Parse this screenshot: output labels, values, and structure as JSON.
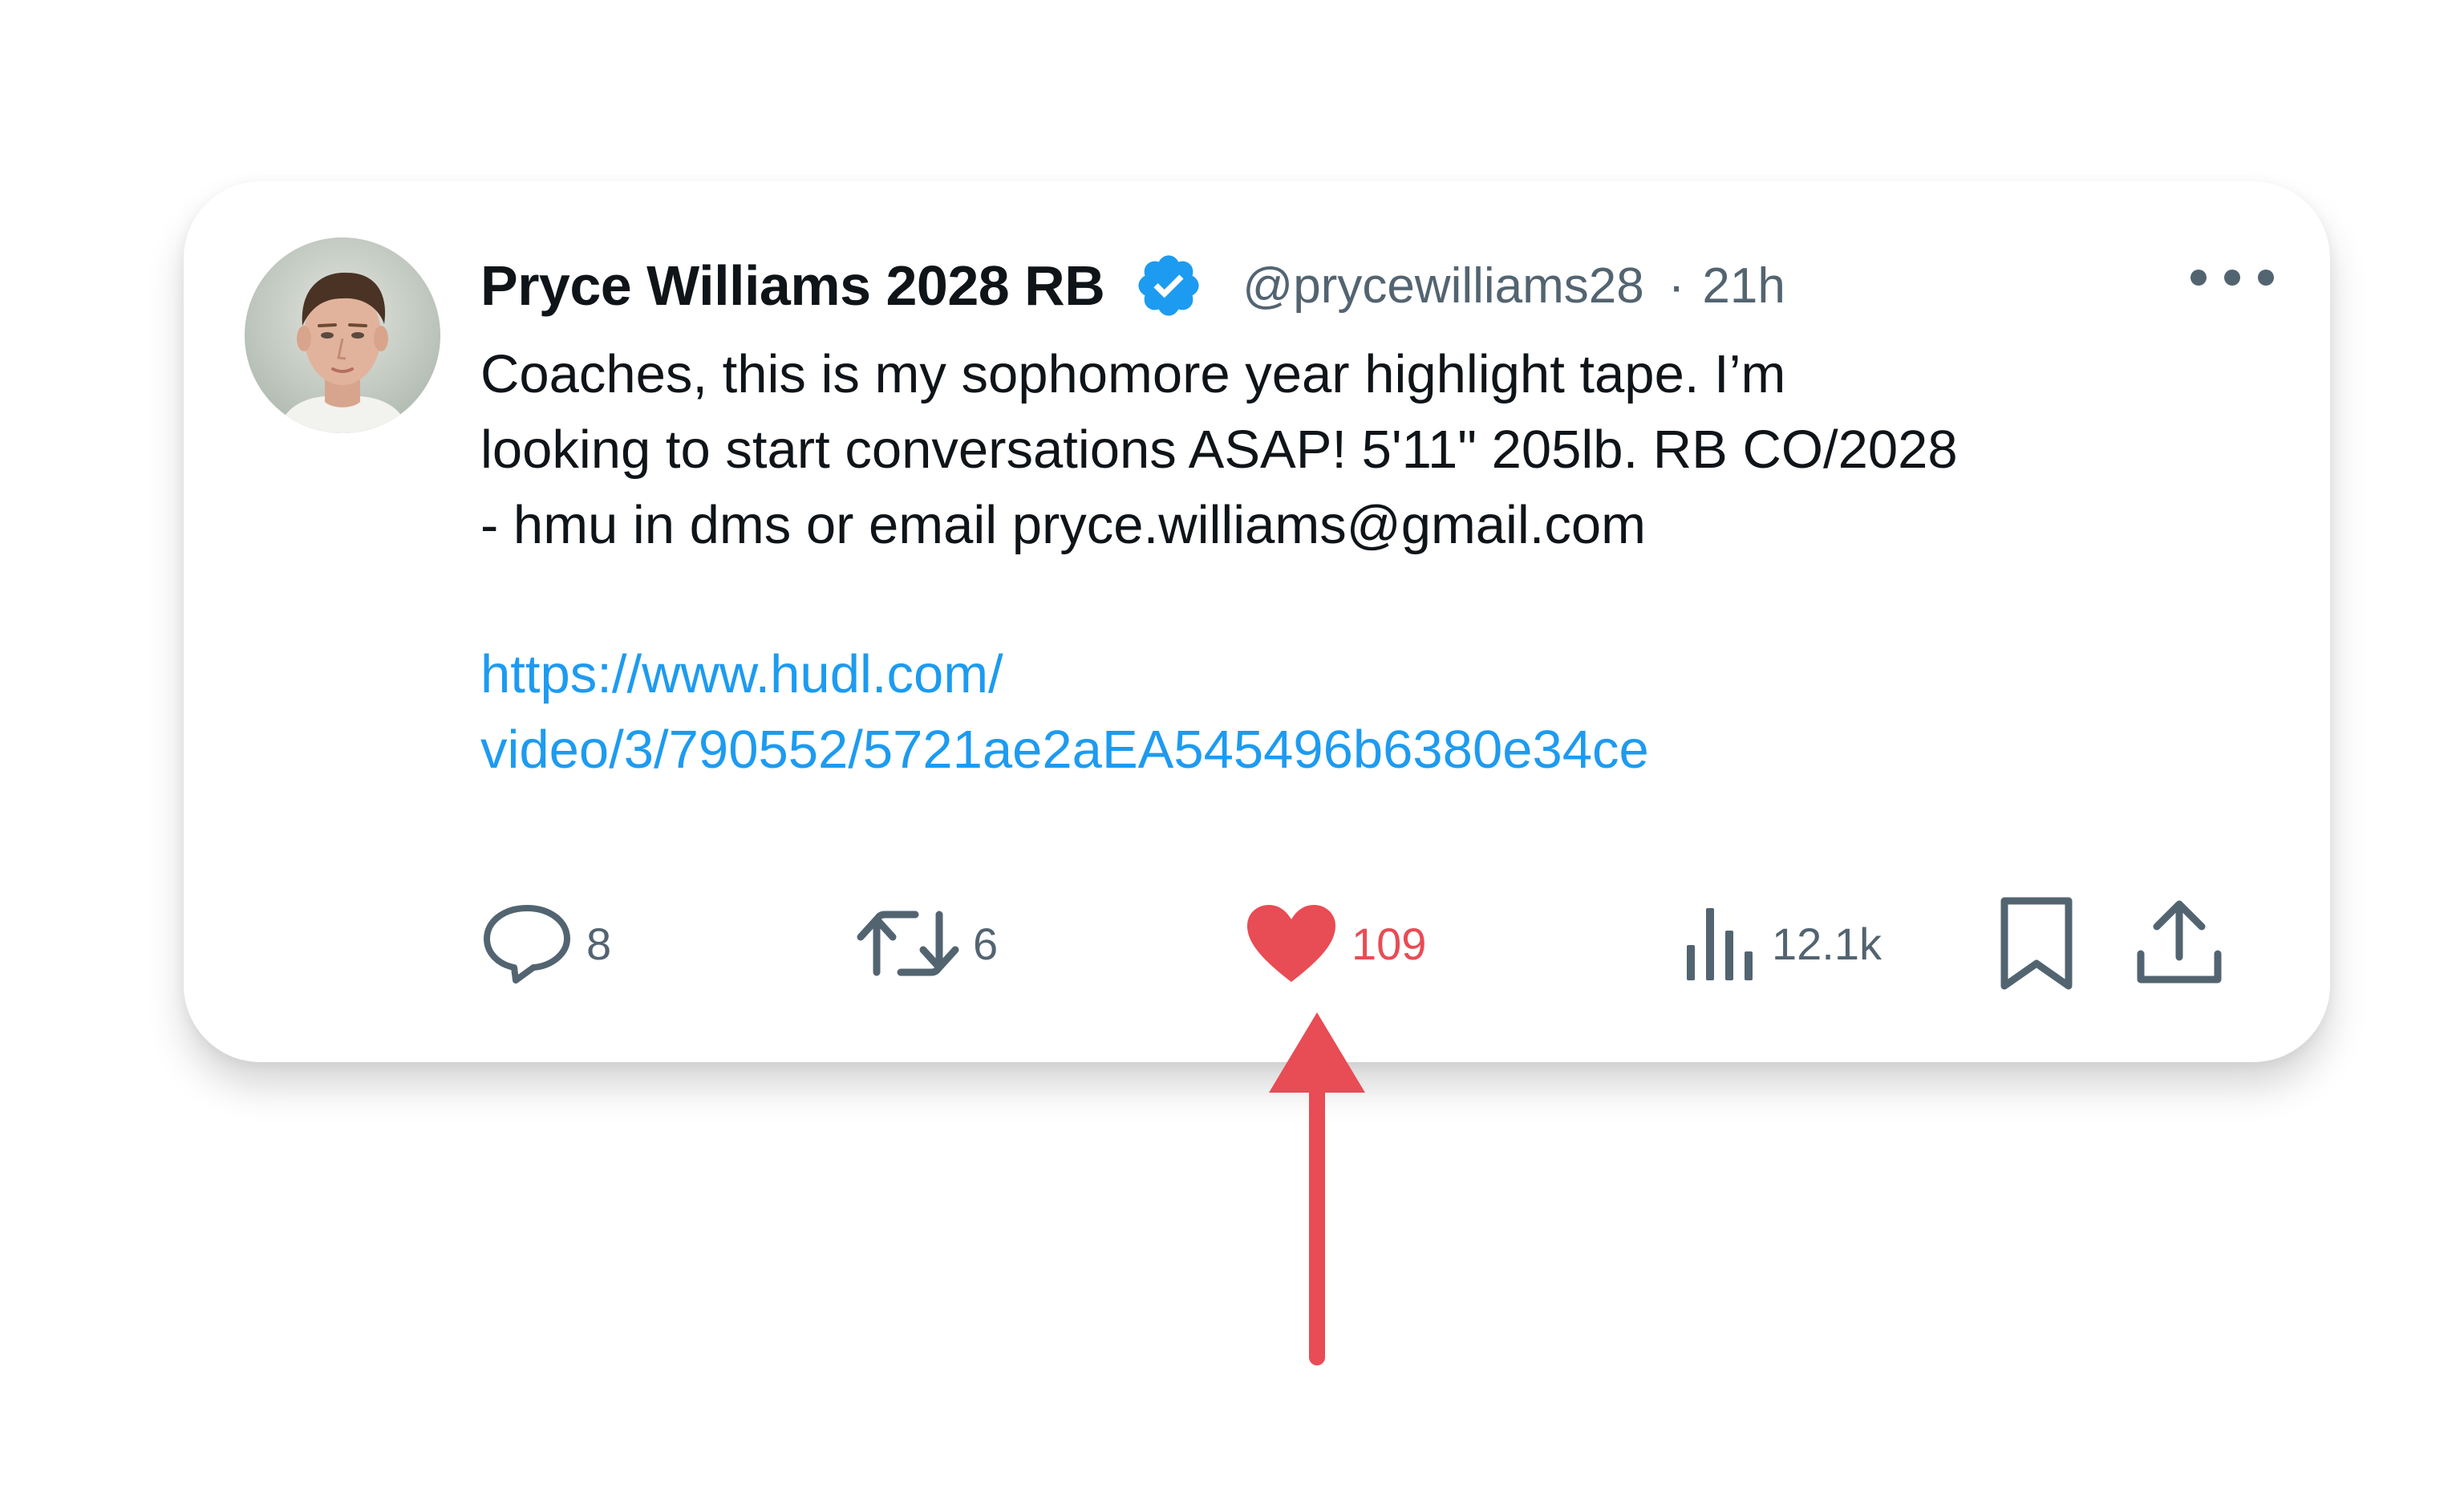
{
  "tweet": {
    "display_name": "Pryce Williams 2028 RB",
    "handle": "@prycewilliams28",
    "separator": "·",
    "time": "21h",
    "text_lines": [
      "Coaches, this is my sophomore year highlight tape. I’m",
      "looking to start conversations ASAP! 5'11\" 205lb. RB CO/2028",
      "- hmu in dms or email pryce.williams@gmail.com"
    ],
    "link_lines": [
      "https://www.hudl.com/",
      "video/3/790552/5721ae2aEA545496b6380e34ce"
    ]
  },
  "actions": {
    "replies": "8",
    "reposts": "6",
    "likes": "109",
    "views": "12.1k"
  },
  "icons": {
    "verified": "verified-badge-icon",
    "more": "more-options-icon",
    "reply": "reply-icon",
    "repost": "repost-icon",
    "like": "heart-icon",
    "views": "views-chart-icon",
    "bookmark": "bookmark-icon",
    "share": "share-upload-icon"
  },
  "colors": {
    "verified_blue": "#1d9bf0",
    "link_blue": "#1d9bf0",
    "like_red": "#e84c55",
    "icon_gray": "#536471",
    "arrow_red": "#e84c55"
  }
}
